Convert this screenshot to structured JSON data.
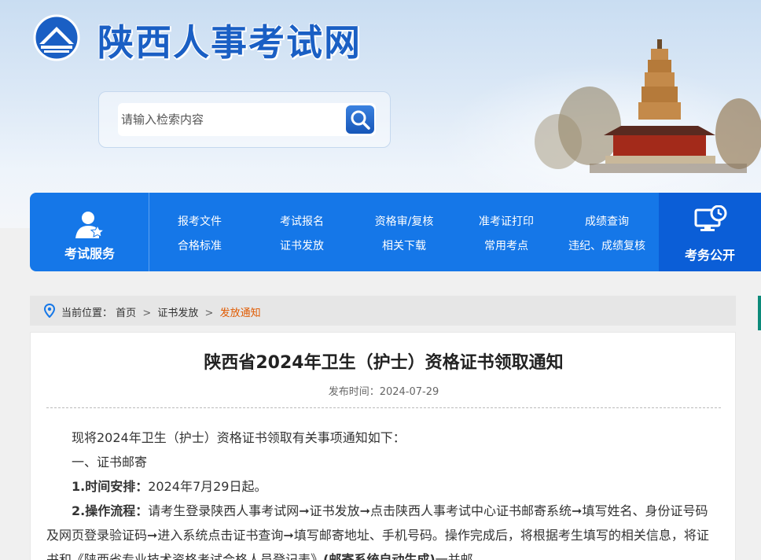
{
  "site": {
    "title": "陕西人事考试网"
  },
  "search": {
    "placeholder": "请输入检索内容"
  },
  "nav": {
    "left_label": "考试服务",
    "right_label": "考务公开",
    "links_row1": [
      "报考文件",
      "考试报名",
      "资格审/复核",
      "准考证打印",
      "成绩查询"
    ],
    "links_row2": [
      "合格标准",
      "证书发放",
      "相关下载",
      "常用考点",
      "违纪、成绩复核"
    ]
  },
  "breadcrumb": {
    "prefix": "当前位置：",
    "home": "首页",
    "section": "证书发放",
    "current": "发放通知",
    "sep": ">"
  },
  "article": {
    "title": "陕西省2024年卫生（护士）资格证书领取通知",
    "date_label": "发布时间：",
    "date": "2024-07-29",
    "p1": "现将2024年卫生（护士）资格证书领取有关事项通知如下：",
    "p2": "一、证书邮寄",
    "p3_bold": "1.时间安排：",
    "p3_text": "2024年7月29日起。",
    "p4_bold": "2.操作流程：",
    "p4_text": "请考生登录陕西人事考试网➞证书发放➞点击陕西人事考试中心证书邮寄系统➞填写姓名、身份证号码及网页登录验证码➞进入系统点击证书查询➞填写邮寄地址、手机号码。操作完成后，将根据考生填写的相关信息，将证书和《陕西省专业技术资格考试合格人员登记表》",
    "p4_bold2": "(邮寄系统自动生成)",
    "p4_tail": "一并邮"
  },
  "colors": {
    "nav_blue": "#1577e8",
    "title_blue": "#1a5fc4",
    "crumb_current": "#e05a00"
  }
}
